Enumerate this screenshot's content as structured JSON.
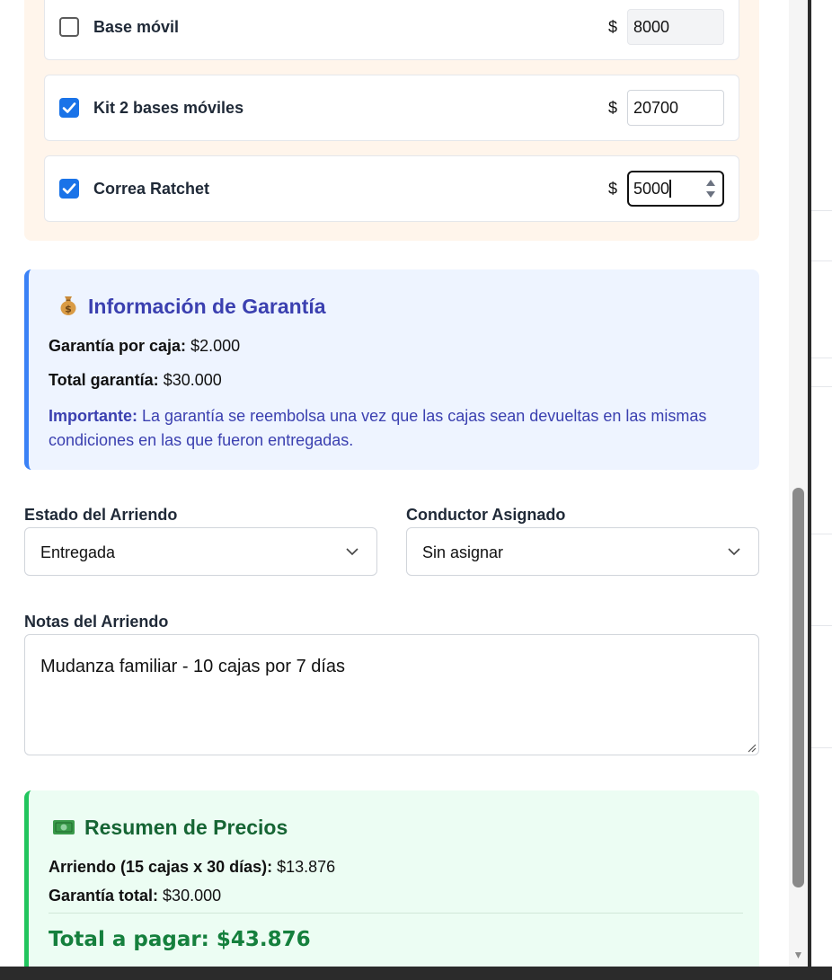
{
  "accessories": [
    {
      "name": "Base móvil",
      "checked": false,
      "currency": "$",
      "price": "8000",
      "disabled": true
    },
    {
      "name": "Kit 2 bases móviles",
      "checked": true,
      "currency": "$",
      "price": "20700",
      "disabled": false
    },
    {
      "name": "Correa Ratchet",
      "checked": true,
      "currency": "$",
      "price": "5000",
      "disabled": false,
      "focused": true
    }
  ],
  "guarantee": {
    "icon": "money-bag-icon",
    "title": "Información de Garantía",
    "per_box_label": "Garantía por caja:",
    "per_box_value": "$2.000",
    "total_label": "Total garantía:",
    "total_value": "$30.000",
    "note_label": "Importante:",
    "note_text": "La garantía se reembolsa una vez que las cajas sean devueltas en las mismas condiciones en las que fueron entregadas."
  },
  "status": {
    "label": "Estado del Arriendo",
    "value": "Entregada"
  },
  "driver": {
    "label": "Conductor Asignado",
    "value": "Sin asignar"
  },
  "notes": {
    "label": "Notas del Arriendo",
    "value": "Mudanza familiar - 10 cajas por 7 días"
  },
  "summary": {
    "icon": "cash-icon",
    "title": "Resumen de Precios",
    "rental_label": "Arriendo (15 cajas x 30 días):",
    "rental_value": "$13.876",
    "guarantee_label": "Garantía total:",
    "guarantee_value": "$30.000",
    "total_label": "Total a pagar:",
    "total_value": "$43.876"
  },
  "colors": {
    "accent_blue": "#1a73e8",
    "guarantee_accent": "#3b82f6",
    "guarantee_text": "#3b40b0",
    "summary_accent": "#22c55e",
    "summary_text": "#15803d",
    "accessory_panel_bg": "#fff5eb"
  }
}
